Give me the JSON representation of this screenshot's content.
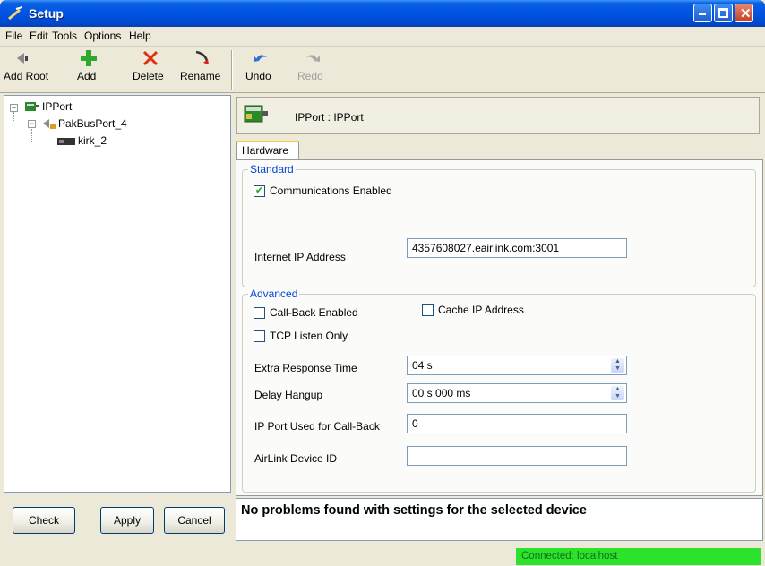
{
  "window": {
    "title": "Setup"
  },
  "menu": [
    "File",
    "Edit",
    "Tools",
    "Options",
    "Help"
  ],
  "toolbar": {
    "add_root": "Add Root",
    "add": "Add",
    "delete": "Delete",
    "rename": "Rename",
    "undo": "Undo",
    "redo": "Redo"
  },
  "tree": {
    "root": "IPPort",
    "child": "PakBusPort_4",
    "grandchild": "kirk_2"
  },
  "left_buttons": {
    "check": "Check",
    "apply": "Apply",
    "cancel": "Cancel"
  },
  "device_header": {
    "title": "IPPort : IPPort"
  },
  "tab": {
    "hardware": "Hardware"
  },
  "standard": {
    "title": "Standard",
    "comm_enabled_label": "Communications Enabled",
    "comm_enabled": true,
    "ip_address_label": "Internet IP Address",
    "ip_address_value": "4357608027.eairlink.com:3001"
  },
  "advanced": {
    "title": "Advanced",
    "callback_label": "Call-Back Enabled",
    "callback": false,
    "cache_ip_label": "Cache IP Address",
    "cache_ip": false,
    "tcp_listen_label": "TCP Listen Only",
    "tcp_listen": false,
    "extra_response_label": "Extra Response Time",
    "extra_response_value": "04 s",
    "delay_hangup_label": "Delay Hangup",
    "delay_hangup_value": "00 s 000 ms",
    "ip_port_callback_label": "IP Port Used for Call-Back",
    "ip_port_callback_value": "0",
    "airlink_id_label": "AirLink Device ID",
    "airlink_id_value": ""
  },
  "message": "No problems found with settings for the selected device",
  "status": {
    "connection": "Connected: localhost"
  },
  "colors": {
    "title_bar": "#0054e3",
    "status_ok": "#2be32b",
    "group_title": "#0046d5"
  }
}
